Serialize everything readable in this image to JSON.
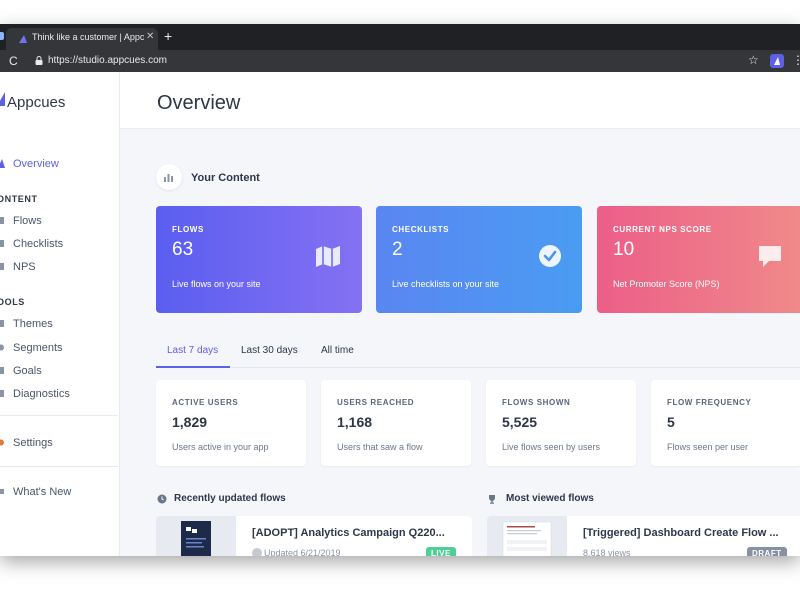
{
  "browser": {
    "tab_title": "Think like a customer | Appcues",
    "tab_close": "✕",
    "new_tab": "+",
    "reload": "C",
    "url": "https://studio.appcues.com",
    "star": "☆",
    "menu": "⋮"
  },
  "sidebar": {
    "brand": "Appcues",
    "overview": "Overview",
    "content_heading": "ONTENT",
    "content_items": [
      {
        "label": "Flows",
        "icon": "map-icon"
      },
      {
        "label": "Checklists",
        "icon": "checklist-icon"
      },
      {
        "label": "NPS",
        "icon": "nps-icon"
      }
    ],
    "tools_heading": "OOLS",
    "tools_items": [
      {
        "label": "Themes",
        "icon": "theme-icon"
      },
      {
        "label": "Segments",
        "icon": "segments-icon"
      },
      {
        "label": "Goals",
        "icon": "goals-icon"
      },
      {
        "label": "Diagnostics",
        "icon": "diagnostics-icon"
      }
    ],
    "settings": "Settings",
    "whats_new": "What's New"
  },
  "header": {
    "title": "Overview"
  },
  "your_content": {
    "title": "Your Content",
    "cards": [
      {
        "label": "FLOWS",
        "value": "63",
        "desc": "Live flows on your site",
        "icon": "map-icon",
        "gradient": [
          "#5a5ef0",
          "#8571f3"
        ]
      },
      {
        "label": "CHECKLISTS",
        "value": "2",
        "desc": "Live checklists on your site",
        "icon": "check-circle-icon",
        "gradient": [
          "#5a86f2",
          "#4a9cf2"
        ]
      },
      {
        "label": "CURRENT NPS SCORE",
        "value": "10",
        "desc": "Net Promoter Score (NPS)",
        "icon": "chat-bubble-icon",
        "gradient": [
          "#ec5e88",
          "#f08a8a"
        ]
      }
    ]
  },
  "periods": {
    "last_7": "Last 7 days",
    "last_30": "Last 30 days",
    "all": "All time"
  },
  "stats": [
    {
      "label": "ACTIVE USERS",
      "value": "1,829",
      "desc": "Users active in your app"
    },
    {
      "label": "USERS REACHED",
      "value": "1,168",
      "desc": "Users that saw a flow"
    },
    {
      "label": "FLOWS SHOWN",
      "value": "5,525",
      "desc": "Live flows seen by users"
    },
    {
      "label": "FLOW FREQUENCY",
      "value": "5",
      "desc": "Flows seen per user"
    }
  ],
  "recent": {
    "heading": "Recently updated flows",
    "title": "[ADOPT] Analytics Campaign Q220...",
    "meta": "Updated 6/21/2019",
    "badge": "LIVE"
  },
  "viewed": {
    "heading": "Most viewed flows",
    "title": "[Triggered] Dashboard Create Flow ...",
    "meta": "8,618 views",
    "badge": "DRAFT"
  },
  "colors": {
    "accent": "#5c5fe8",
    "live": "#4ecf96",
    "draft": "#8791a3"
  }
}
